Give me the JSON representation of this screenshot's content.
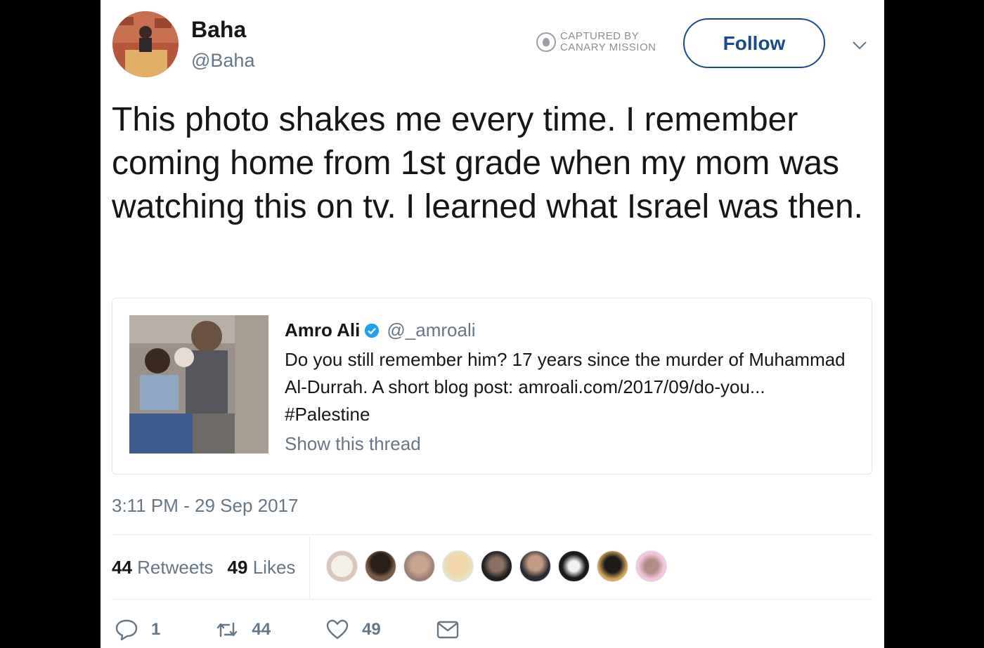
{
  "author": {
    "name": "Baha",
    "handle": "@Baha"
  },
  "captured": {
    "line1": "CAPTURED BY",
    "line2": "CANARY MISSION"
  },
  "follow_label": "Follow",
  "tweet_text": "This photo shakes me every time. I remember coming home from 1st grade when my mom was watching this on tv. I learned what Israel was then.",
  "quoted": {
    "name": "Amro Ali",
    "handle": "@_amroali",
    "text": "Do you still remember him? 17 years since the murder of Muhammad Al-Durrah. A short blog post: amroali.com/2017/09/do-you... #Palestine",
    "thread_link": "Show this thread"
  },
  "timestamp": "3:11 PM - 29 Sep 2017",
  "stats": {
    "retweets_count": "44",
    "retweets_label": "Retweets",
    "likes_count": "49",
    "likes_label": "Likes"
  },
  "likers": [
    "liker-1",
    "liker-2",
    "liker-3",
    "liker-4",
    "liker-5",
    "liker-6",
    "liker-7",
    "liker-8",
    "liker-9"
  ],
  "actions": {
    "reply_count": "1",
    "retweet_count": "44",
    "like_count": "49"
  },
  "colors": {
    "link": "#1b4a8a",
    "secondary": "#657786",
    "verified": "#1da1f2"
  }
}
